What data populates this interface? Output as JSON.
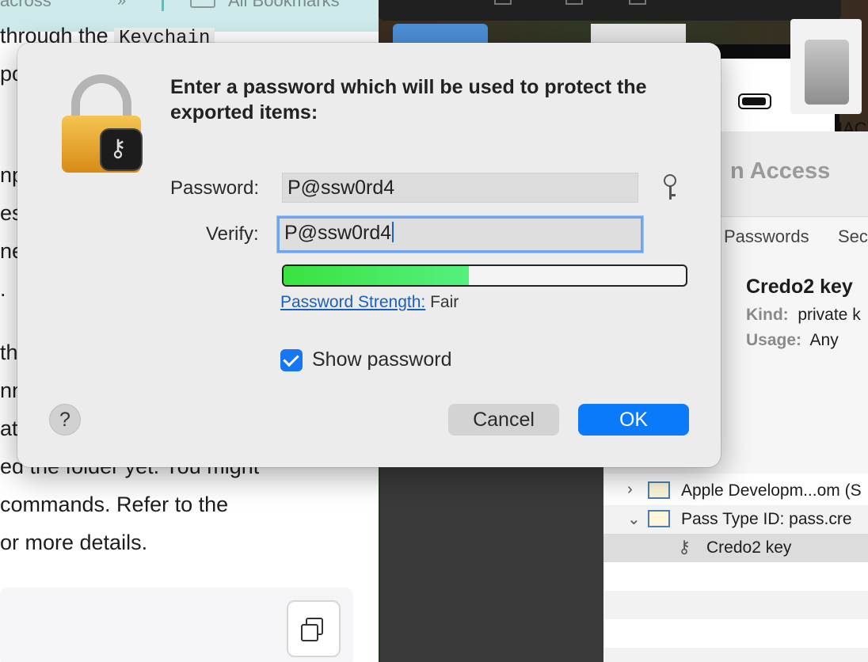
{
  "background": {
    "browser": {
      "toolbar": {
        "text_left": "across",
        "chevrons": "»",
        "bookmarks_label": "All Bookmarks"
      },
      "doc_lines": [
        {
          "text": "through the ",
          "code": "Keychain"
        },
        {
          "text": "po"
        },
        {
          "text": "np"
        },
        {
          "text": "es"
        },
        {
          "text": "ne"
        },
        {
          "text": "."
        },
        {
          "text": "th"
        },
        {
          "text": "nn"
        },
        {
          "text": "at"
        },
        {
          "text": "ed the folder yet. You might"
        },
        {
          "text": "commands. Refer to the"
        },
        {
          "text": "or more details."
        }
      ]
    },
    "keychain": {
      "title": "n Access",
      "tabs": [
        "Passwords",
        "Sec"
      ],
      "item_title": "Credo2 key",
      "kind_label": "Kind:",
      "kind_value": "private k",
      "usage_label": "Usage:",
      "usage_value": "Any",
      "rows": [
        {
          "label": "Apple Developm...om (S",
          "chevron": "›"
        },
        {
          "label": "Pass Type ID: pass.cre",
          "chevron": "⌄"
        },
        {
          "label": "Credo2 key"
        }
      ]
    },
    "desktop": {
      "phone_label": "IAC"
    }
  },
  "dialog": {
    "prompt": "Enter a password which will be used to protect the exported items:",
    "password_label": "Password:",
    "password_value": "P@ssw0rd4",
    "verify_label": "Verify:",
    "verify_value": "P@ssw0rd4",
    "strength_link": "Password Strength:",
    "strength_value": "Fair",
    "strength_level": 0.46,
    "show_password_label": "Show password",
    "show_password_checked": true,
    "help_label": "?",
    "cancel_label": "Cancel",
    "ok_label": "OK",
    "icons": {
      "lock": "keychain-lock-icon",
      "key": "password-assistant-key-icon"
    },
    "colors": {
      "accent": "#0a7afa",
      "meter": "#39e33f"
    }
  }
}
